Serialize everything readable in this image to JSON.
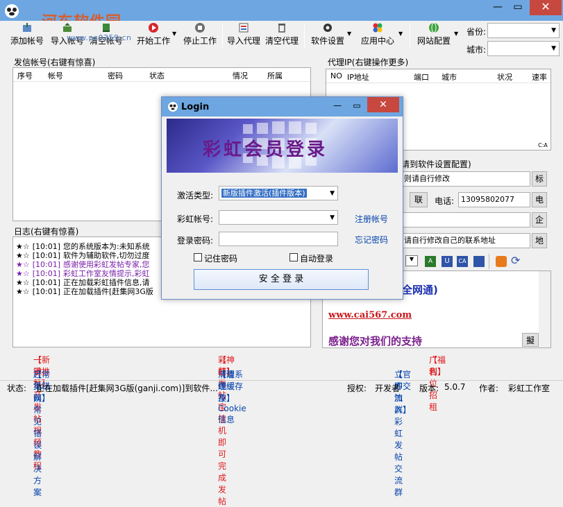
{
  "window": {
    "watermark": "河东软件园",
    "watermark_url": "www.pc0359.cn"
  },
  "toolbar": {
    "items": [
      {
        "label": "添加帐号",
        "icon": "add-account-icon"
      },
      {
        "label": "导入帐号",
        "icon": "import-account-icon"
      },
      {
        "label": "清空帐号",
        "icon": "clear-account-icon"
      },
      {
        "label": "开始工作",
        "icon": "play-icon"
      },
      {
        "label": "停止工作",
        "icon": "stop-icon"
      },
      {
        "label": "导入代理",
        "icon": "import-proxy-icon"
      },
      {
        "label": "清空代理",
        "icon": "trash-icon"
      },
      {
        "label": "软件设置",
        "icon": "settings-icon"
      },
      {
        "label": "应用中心",
        "icon": "app-center-icon"
      },
      {
        "label": "网站配置",
        "icon": "globe-icon"
      }
    ],
    "province_label": "省份:",
    "city_label": "城市:"
  },
  "accounts": {
    "title": "发信帐号(右键有惊喜)",
    "columns": [
      "序号",
      "帐号",
      "密码",
      "状态",
      "情况",
      "所属"
    ]
  },
  "proxy": {
    "title": "代理IP(右键操作更多)",
    "columns": [
      "NO",
      "IP地址",
      "端口",
      "城市",
      "状况",
      "速率"
    ]
  },
  "settings": {
    "config_hint": "请到软件设置配置)",
    "hint_modify": "则请自行修改",
    "tel_label": "电话:",
    "tel_value": "13095802077",
    "contact_hint": "请自行修改自己的联系地址",
    "btn_biao": "标",
    "btn_lian": "联",
    "btn_dian": "电",
    "btn_qi": "企",
    "btn_di": "地",
    "btn_ni": "擬",
    "content_line1": "全网通)",
    "content_url": "www.cai567.com",
    "content_thanks": "感谢您对我们的支持",
    "btn_ni_label": "擬"
  },
  "log": {
    "title": "日志(右键有惊喜)",
    "lines": [
      {
        "star": "★☆",
        "time": "[10:01]",
        "text": "您的系统版本为:未知系统",
        "color": "#000000"
      },
      {
        "star": "★☆",
        "time": "[10:01]",
        "text": "软件为辅助软件,切勿过度",
        "color": "#000000"
      },
      {
        "star": "★☆",
        "time": "[10:01]",
        "text": "感谢使用彩虹发帖专家,您",
        "color": "#7a1fa8"
      },
      {
        "star": "★☆",
        "time": "[10:01]",
        "text": "彩虹工作室友情提示,彩虹",
        "color": "#7a1fa8"
      },
      {
        "star": "★☆",
        "time": "[10:01]",
        "text": "正在加载彩虹插件信息,请",
        "color": "#000000"
      },
      {
        "star": "★☆",
        "time": "[10:01]",
        "text": "正在加载插件[赶集网3G版",
        "color": "#000000"
      }
    ]
  },
  "login": {
    "title": "Login",
    "banner": "彩虹会员登录",
    "activation_label": "激活类型:",
    "activation_value": "新版插件激活(插件版本)",
    "account_label": "彩虹帐号:",
    "register_link": "注册帐号",
    "password_label": "登录密码:",
    "forgot_link": "忘记密码",
    "remember_label": "记住密码",
    "autologin_label": "自动登录",
    "login_button": "安 全 登 录"
  },
  "links": [
    {
      "tag": "【新手推荐】",
      "text": "一键打开发帖视频教程"
    },
    {
      "tag": "【神器】",
      "text": "彩虹发帖宝挂机即可完成发帖"
    },
    {
      "tag": "【福利】",
      "text": "广告位招租"
    },
    {
      "tag": "【常见错误】",
      "text": "赶集网常见错误解决方案"
    },
    {
      "tag": "【清理缓存】",
      "text": "清理系统缓存及Cookie信息"
    },
    {
      "tag": "【官方交流群】",
      "text": "立即加入彩虹发帖交流群"
    }
  ],
  "status": {
    "label": "状态:",
    "text": "正在加载插件[赶集网3G版(ganji.com)]到软件...",
    "auth_label": "授权:",
    "auth_value": "开发者",
    "version_label": "版本:",
    "version_value": "5.0.7",
    "author_label": "作者:",
    "author_value": "彩虹工作室"
  }
}
